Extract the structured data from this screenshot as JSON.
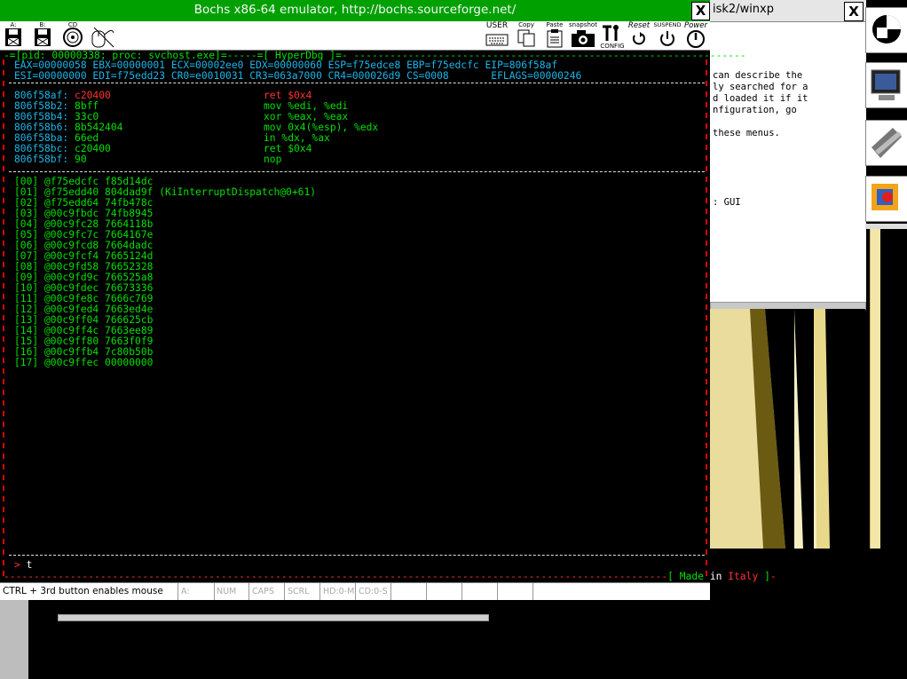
{
  "background": {
    "window_title": "isk2/winxp",
    "close_glyph": "X",
    "help_lines": [
      "can describe the",
      "ly searched for a",
      "d loaded it if it",
      "nfiguration, go",
      "",
      "these menus.",
      "",
      "",
      "",
      "",
      "",
      ": GUI"
    ]
  },
  "bochs": {
    "title": "Bochs x86-64 emulator, http://bochs.sourceforge.net/",
    "close_glyph": "X",
    "toolbar": {
      "floppy_a": "A:",
      "floppy_b": "B:",
      "cdrom": "CD",
      "mouse": "",
      "user": "USER",
      "copy": "Copy",
      "paste": "Paste",
      "snapshot": "snapshot",
      "config": "CONFIG",
      "reset": "Reset",
      "suspend": "SUSPEND",
      "power": "Power"
    },
    "status": {
      "mouse_hint": "CTRL + 3rd button enables mouse",
      "a": "A:",
      "num": "NUM",
      "caps": "CAPS",
      "scrl": "SCRL",
      "hd": "HD:0-M",
      "cd": "CD:0-S"
    }
  },
  "hyperdbg": {
    "header_prefix": "-=[pid: 00000338; proc: svchost.exe]=-----=[ HyperDbg ]=-",
    "registers": [
      "EAX=00000058 EBX=00000001 ECX=00002ee0 EDX=00000060 ESP=f75edce8 EBP=f75edcfc EIP=806f58af",
      "ESI=00000000 EDI=f75edd23 CR0=e0010031 CR3=063a7000 CR4=000026d9 CS=0008       EFLAGS=00000246"
    ],
    "disasm": [
      {
        "addr": "806f58af:",
        "bytes": "c20400",
        "instr": "ret $0x4",
        "current": true
      },
      {
        "addr": "806f58b2:",
        "bytes": "8bff",
        "instr": "mov %edi, %edi",
        "current": false
      },
      {
        "addr": "806f58b4:",
        "bytes": "33c0",
        "instr": "xor %eax, %eax",
        "current": false
      },
      {
        "addr": "806f58b6:",
        "bytes": "8b542404",
        "instr": "mov 0x4(%esp), %edx",
        "current": false
      },
      {
        "addr": "806f58ba:",
        "bytes": "66ed",
        "instr": "in %dx, %ax",
        "current": false
      },
      {
        "addr": "806f58bc:",
        "bytes": "c20400",
        "instr": "ret $0x4",
        "current": false
      },
      {
        "addr": "806f58bf:",
        "bytes": "90",
        "instr": "nop",
        "current": false
      }
    ],
    "stack": [
      "[00] @f75edcfc f85d14dc",
      "[01] @f75edd40 804dad9f (KiInterruptDispatch@0+61)",
      "[02] @f75edd64 74fb478c",
      "[03] @00c9fbdc 74fb8945",
      "[04] @00c9fc28 7664118b",
      "[05] @00c9fc7c 7664167e",
      "[06] @00c9fcd8 7664dadc",
      "[07] @00c9fcf4 7665124d",
      "[08] @00c9fd58 76652328",
      "[09] @00c9fd9c 766525a8",
      "[10] @00c9fdec 76673336",
      "[11] @00c9fe8c 7666c769",
      "[12] @00c9fed4 7663ed4e",
      "[13] @00c9ff04 766625cb",
      "[14] @00c9ff4c 7663ee89",
      "[15] @00c9ff80 7663f0f9",
      "[16] @00c9ffb4 7c80b50b",
      "[17] @00c9ffec 00000000"
    ],
    "prompt": ">",
    "command": "t",
    "footer_open": "[",
    "footer_made": "Made",
    "footer_in": "in",
    "footer_italy": "Italy",
    "footer_close": "]",
    "colors": {
      "text": "#00e000",
      "address": "#1cb6e8",
      "current": "#ff3030",
      "border": "#e00000"
    }
  }
}
